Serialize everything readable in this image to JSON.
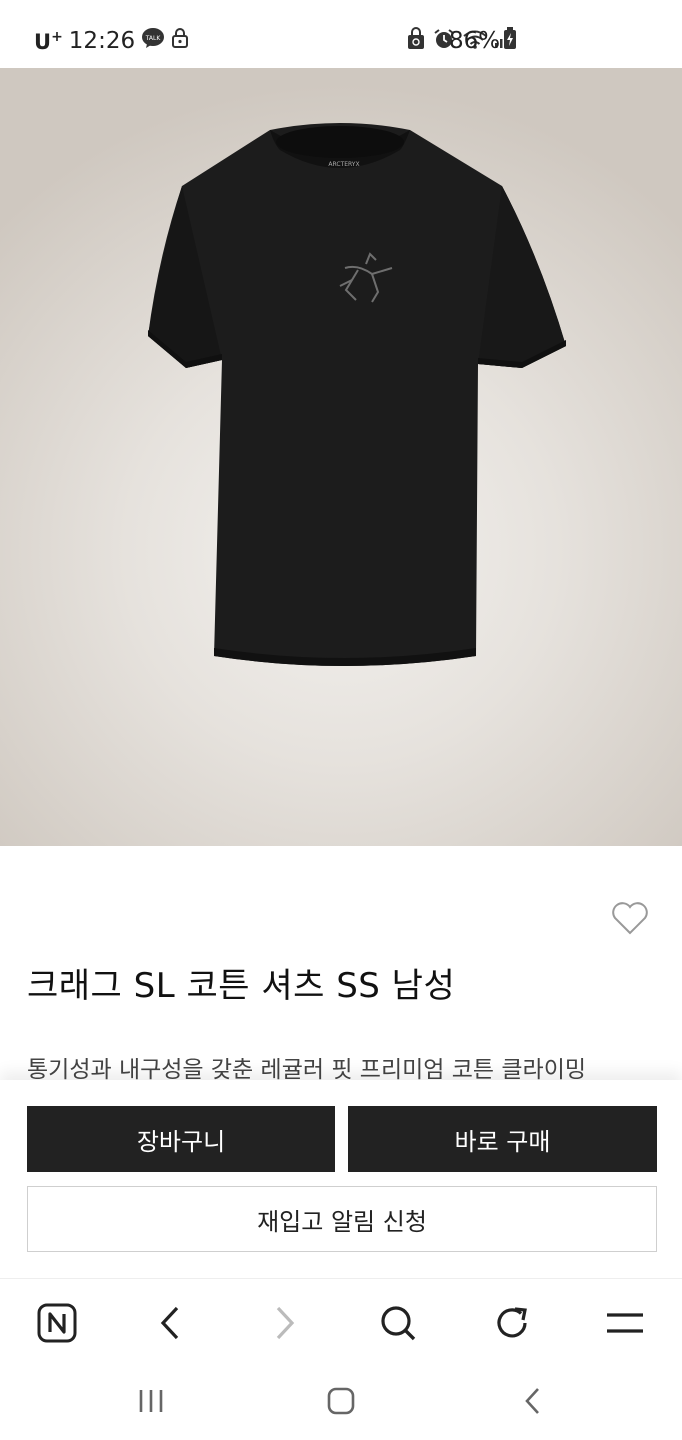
{
  "status_bar": {
    "carrier": "U",
    "carrier_sup": "+",
    "time": "12:26",
    "battery": "86%",
    "icons": [
      "talk-icon",
      "lock-icon",
      "vpn-icon",
      "alarm-icon",
      "wifi-icon",
      "signal-icon",
      "battery-icon"
    ]
  },
  "product": {
    "title": "크래그 SL 코튼 셔츠 SS 남성",
    "description": "통기성과 내구성을 갖춘 레귤러 핏 프리미엄 코튼 클라이밍",
    "image_alt": "black t-shirt",
    "wishlist_icon": "heart-icon"
  },
  "actions": {
    "cart_label": "장바구니",
    "buy_label": "바로 구매",
    "restock_label": "재입고 알림 신청"
  },
  "browser_toolbar": {
    "icons": [
      "naver-home-icon",
      "back-icon",
      "forward-icon",
      "search-icon",
      "refresh-icon",
      "menu-icon"
    ]
  },
  "system_nav": {
    "icons": [
      "recents-icon",
      "home-icon",
      "back-nav-icon"
    ]
  },
  "colors": {
    "button_dark": "#222222",
    "background": "#ffffff",
    "disabled_icon": "#bbbbbb"
  }
}
